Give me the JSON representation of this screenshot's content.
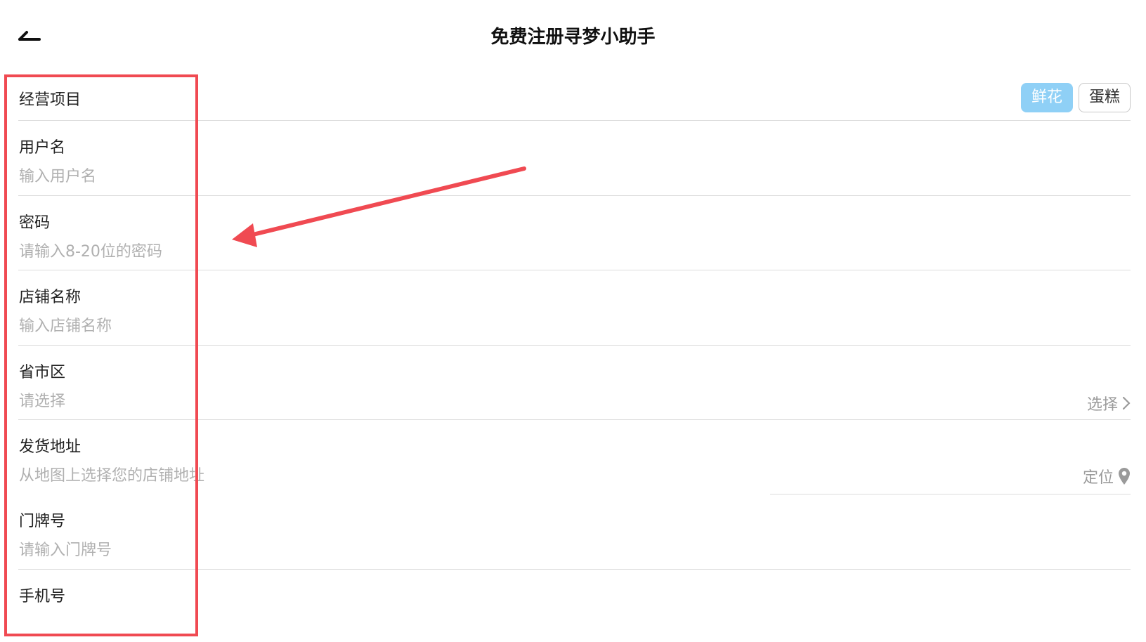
{
  "header": {
    "title": "免费注册寻梦小助手"
  },
  "business": {
    "label": "经营项目",
    "options": [
      "鲜花",
      "蛋糕"
    ],
    "selected": "鲜花"
  },
  "username": {
    "label": "用户名",
    "placeholder": "输入用户名",
    "value": ""
  },
  "password": {
    "label": "密码",
    "placeholder": "请输入8-20位的密码",
    "value": ""
  },
  "shop_name": {
    "label": "店铺名称",
    "placeholder": "输入店铺名称",
    "value": ""
  },
  "region": {
    "label": "省市区",
    "placeholder": "请选择",
    "action": "选择"
  },
  "address": {
    "label": "发货地址",
    "placeholder": "从地图上选择您的店铺地址",
    "action": "定位"
  },
  "door_number": {
    "label": "门牌号",
    "placeholder": "请输入门牌号",
    "value": ""
  },
  "phone": {
    "label": "手机号"
  },
  "colors": {
    "accent": "#8fd0f6",
    "annotation": "#f04a52",
    "placeholder": "#b0b0b0"
  },
  "icons": {
    "back": "back-arrow-icon",
    "chevron": "chevron-right-icon",
    "location": "map-pin-icon"
  }
}
